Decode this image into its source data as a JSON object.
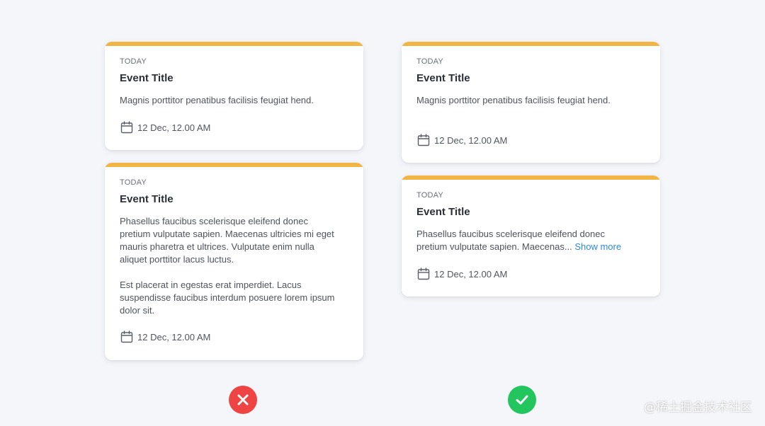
{
  "colors": {
    "background": "#f5f6fa",
    "card_accent": "#f0b545",
    "link": "#2f88d8",
    "bad": "#ef4444",
    "good": "#22c55e"
  },
  "left_column": {
    "card_short": {
      "label": "TODAY",
      "title": "Event Title",
      "description": "Magnis porttitor penatibus facilisis feugiat hend.",
      "date": "12 Dec, 12.00 AM",
      "icon": "calendar-icon"
    },
    "card_long": {
      "label": "TODAY",
      "title": "Event Title",
      "paragraph1_lines": [
        "Phasellus faucibus scelerisque eleifend donec",
        "pretium vulputate sapien. Maecenas ultricies mi eget",
        "mauris pharetra et ultrices. Vulputate enim nulla",
        "aliquet porttitor lacus luctus."
      ],
      "paragraph2_lines": [
        "Est placerat in egestas erat imperdiet. Lacus",
        "suspendisse faucibus interdum posuere lorem ipsum",
        "dolor sit."
      ],
      "date": "12 Dec, 12.00 AM",
      "icon": "calendar-icon"
    },
    "status_icon": "x-circle-icon"
  },
  "right_column": {
    "card_short": {
      "label": "TODAY",
      "title": "Event Title",
      "description": "Magnis porttitor penatibus facilisis feugiat hend.",
      "date": "12 Dec, 12.00 AM",
      "icon": "calendar-icon"
    },
    "card_truncated": {
      "label": "TODAY",
      "title": "Event Title",
      "line1": "Phasellus faucibus scelerisque eleifend donec",
      "line2": "pretium vulputate sapien. Maecenas...",
      "show_more": "Show more",
      "date": "12 Dec, 12.00 AM",
      "icon": "calendar-icon"
    },
    "status_icon": "check-circle-icon"
  },
  "watermark": "@稀土掘金技术社区"
}
